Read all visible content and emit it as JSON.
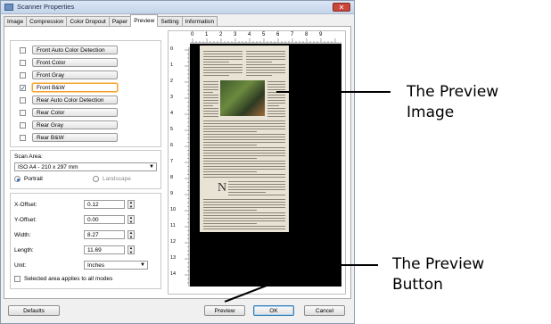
{
  "window": {
    "title": "Scanner Properties",
    "close_glyph": "✕"
  },
  "tabs": [
    "Image",
    "Compression",
    "Color Dropout",
    "Paper",
    "Preview",
    "Setting",
    "Information"
  ],
  "active_tab": "Preview",
  "modes": [
    {
      "label": "Front Auto Color Detection",
      "checked": false
    },
    {
      "label": "Front Color",
      "checked": false
    },
    {
      "label": "Front Gray",
      "checked": false
    },
    {
      "label": "Front B&W",
      "checked": true
    },
    {
      "label": "Rear Auto Color Detection",
      "checked": false
    },
    {
      "label": "Rear Color",
      "checked": false
    },
    {
      "label": "Rear Gray",
      "checked": false
    },
    {
      "label": "Rear B&W",
      "checked": false
    }
  ],
  "scan_area": {
    "label": "Scan Area:",
    "value": "ISO A4 - 210 x 297 mm",
    "portrait_label": "Portrait",
    "landscape_label": "Landscape",
    "orientation": "Portrait"
  },
  "offsets": {
    "x_label": "X-Offset:",
    "x_value": "0.12",
    "y_label": "Y-Offset:",
    "y_value": "0.00",
    "width_label": "Width:",
    "width_value": "8.27",
    "length_label": "Length:",
    "length_value": "11.69",
    "unit_label": "Unit:",
    "unit_value": "Inches",
    "applies_label": "Selected area applies to all modes"
  },
  "ruler": {
    "top": [
      "0",
      "1",
      "2",
      "3",
      "4",
      "5",
      "6",
      "7",
      "8",
      "9"
    ],
    "left": [
      "0",
      "1",
      "2",
      "3",
      "4",
      "5",
      "6",
      "7",
      "8",
      "9",
      "10",
      "11",
      "12",
      "13",
      "14"
    ]
  },
  "buttons": {
    "defaults": "Defaults",
    "preview": "Preview",
    "ok": "OK",
    "cancel": "Cancel"
  },
  "callouts": {
    "preview_image_line1": "The Preview",
    "preview_image_line2": "Image",
    "preview_button_line1": "The Preview",
    "preview_button_line2": "Button"
  }
}
